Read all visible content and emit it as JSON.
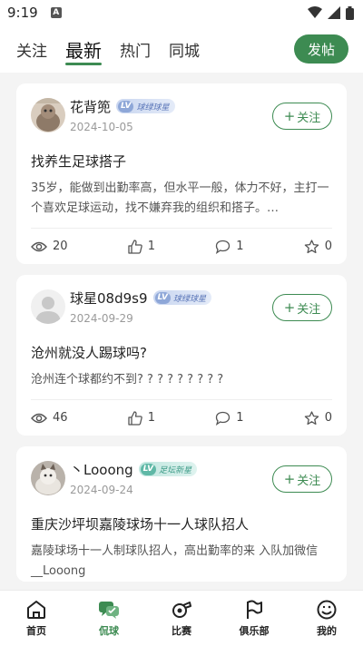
{
  "status": {
    "time": "9:19",
    "notif_letter": "A"
  },
  "tabs": [
    {
      "label": "关注",
      "active": false
    },
    {
      "label": "最新",
      "active": true
    },
    {
      "label": "热门",
      "active": false
    },
    {
      "label": "同城",
      "active": false
    }
  ],
  "post_button": "发帖",
  "follow_label": "关注",
  "posts": [
    {
      "username": "花背篼",
      "level": "球绿球星",
      "date": "2024-10-05",
      "title": "找养生足球搭子",
      "body": "35岁，能做到出勤率高，但水平一般，体力不好，主打一个喜欢足球运动，找不嫌弃我的组织和搭子。…",
      "views": "20",
      "likes": "1",
      "comments": "1",
      "stars": "0"
    },
    {
      "username": "球星08d9s9",
      "level": "球绿球星",
      "date": "2024-09-29",
      "title": "沧州就没人踢球吗?",
      "body": "沧州连个球都约不到? ? ? ? ? ? ? ? ?",
      "views": "46",
      "likes": "1",
      "comments": "1",
      "stars": "0"
    },
    {
      "username": "丶Looong",
      "level": "足坛新星",
      "date": "2024-09-24",
      "title": "重庆沙坪坝嘉陵球场十一人球队招人",
      "body": "嘉陵球场十一人制球队招人，高出勤率的来 入队加微信__Looong"
    }
  ],
  "nav": [
    {
      "label": "首页",
      "icon": "home-icon",
      "active": false
    },
    {
      "label": "侃球",
      "icon": "chat-icon",
      "active": true
    },
    {
      "label": "比赛",
      "icon": "whistle-icon",
      "active": false
    },
    {
      "label": "俱乐部",
      "icon": "flag-icon",
      "active": false
    },
    {
      "label": "我的",
      "icon": "profile-icon",
      "active": false
    }
  ],
  "colors": {
    "accent": "#3d8b52",
    "background": "#f4f4f4"
  }
}
